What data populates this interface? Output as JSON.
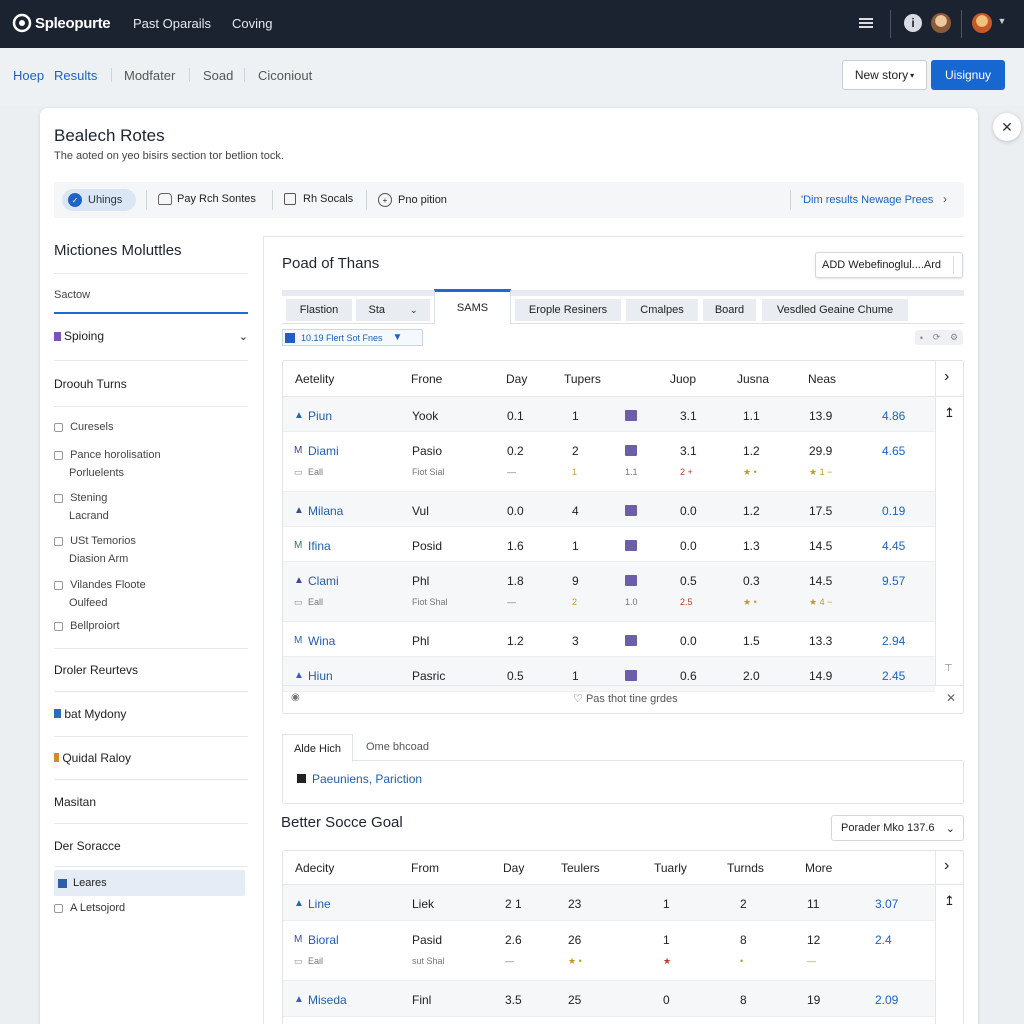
{
  "topbar": {
    "brand": "Spleopurte",
    "nav": [
      "Past Oparails",
      "Coving"
    ]
  },
  "subnav": {
    "items": [
      "Hoep",
      "Results",
      "Modfater",
      "Soad",
      "Ciconiout"
    ],
    "new_story": "New story",
    "primary": "Uisignuy"
  },
  "card": {
    "title": "Bealech Rotes",
    "subtitle": "The aoted on yeo bisirs section tor betlion tock.",
    "filters": [
      "Uhings",
      "Pay Rch Sontes",
      "Rh Socals",
      "Pno pition"
    ],
    "filters_link": "'Dim results Newage Prees"
  },
  "sidebar": {
    "heading": "Mictiones Moluttles",
    "section": "Sactow",
    "dropdown": "Spioing",
    "group": "Droouh Turns",
    "checks": [
      [
        "Curesels"
      ],
      [
        "Pance horolisation",
        "Porluelents"
      ],
      [
        "Stening",
        "Lacrand"
      ],
      [
        "USt Temorios",
        "Diasion Arm"
      ],
      [
        "Vilandes Floote",
        "Oulfeed"
      ],
      [
        "Bellproiort"
      ]
    ],
    "links": [
      "Droler Reurtevs",
      "bat Mydony",
      "Quidal Raloy",
      "Masitan",
      "Der Soracce"
    ],
    "item_active": "Leares",
    "item_last": "A Letsojord"
  },
  "main": {
    "title": "Poad of Thans",
    "add_btn": "ADD Webefinoglul....Ard",
    "tabs": [
      "Flastion",
      "Sta",
      "SAMS",
      "Erople Resiners",
      "Cmalpes",
      "Board",
      "Vesdled Geaine Chume"
    ],
    "filter_select": "10.19 Flert Sot Fnes",
    "headers": [
      "Aetelity",
      "Frone",
      "Day",
      "Tupers",
      "Juop",
      "Jusna",
      "Neas"
    ],
    "rows": [
      {
        "name": "Piun",
        "c2": "Yook",
        "c3": "0.1",
        "c4": "1",
        "c5": "3.1",
        "c6": "1.1",
        "c7": "13.9",
        "c8": "4.86"
      },
      {
        "name": "Diami",
        "c2": "Pasio",
        "c3": "0.2",
        "c4": "2",
        "c5": "3.1",
        "c6": "1.2",
        "c7": "29.9",
        "c8": "4.65",
        "sub": {
          "label": "Eall",
          "c2": "Fiot Sial",
          "c3": "—",
          "c4": "1",
          "c4b": "1.1",
          "c5": "2 +",
          "c6": "★ •",
          "c7": "★ 1 −"
        }
      },
      {
        "name": "Milana",
        "c2": "Vul",
        "c3": "0.0",
        "c4": "4",
        "c5": "0.0",
        "c6": "1.2",
        "c7": "17.5",
        "c8": "0.19"
      },
      {
        "name": "Ifina",
        "c2": "Posid",
        "c3": "1.6",
        "c4": "1",
        "c5": "0.0",
        "c6": "1.3",
        "c7": "14.5",
        "c8": "4.45"
      },
      {
        "name": "Clami",
        "c2": "Phl",
        "c3": "1.8",
        "c4": "9",
        "c5": "0.5",
        "c6": "0.3",
        "c7": "14.5",
        "c8": "9.57",
        "sub": {
          "label": "Eall",
          "c2": "Fiot Shal",
          "c3": "—",
          "c4": "2",
          "c4b": "1.0",
          "c5": "2.5",
          "c6": "★ •",
          "c7": "★ 4 −"
        }
      },
      {
        "name": "Wina",
        "c2": "Phl",
        "c3": "1.2",
        "c4": "3",
        "c5": "0.0",
        "c6": "1.5",
        "c7": "13.3",
        "c8": "2.94"
      },
      {
        "name": "Hiun",
        "c2": "Pasric",
        "c3": "0.5",
        "c4": "1",
        "c5": "0.6",
        "c6": "2.0",
        "c7": "14.9",
        "c8": "2.45"
      }
    ],
    "footer": "Pas thot tine grdes",
    "tabs2": [
      "Alde Hich",
      "Ome bhcoad"
    ],
    "tabs2_content": "Paeuniens, Pariction"
  },
  "second": {
    "title": "Better Socce Goal",
    "select": "Porader Mko 137.6",
    "headers": [
      "Adecity",
      "From",
      "Day",
      "Teulers",
      "Tuarly",
      "Turnds",
      "More"
    ],
    "rows": [
      {
        "name": "Line",
        "c2": "Liek",
        "c3": "2 1",
        "c4": "23",
        "c5": "1",
        "c6": "2",
        "c7": "11",
        "c8": "3.07"
      },
      {
        "name": "Bioral",
        "c2": "Pasid",
        "c3": "2.6",
        "c4": "26",
        "c5": "1",
        "c6": "8",
        "c7": "12",
        "c8": "2.4",
        "sub": {
          "label": "Eail",
          "c2": "sut Shal",
          "c3": "—",
          "c4": "★ •",
          "c5": "★",
          "c6": "•",
          "c7": "—"
        }
      },
      {
        "name": "Miseda",
        "c2": "Finl",
        "c3": "3.5",
        "c4": "25",
        "c5": "0",
        "c6": "8",
        "c7": "19",
        "c8": "2.09"
      }
    ]
  }
}
